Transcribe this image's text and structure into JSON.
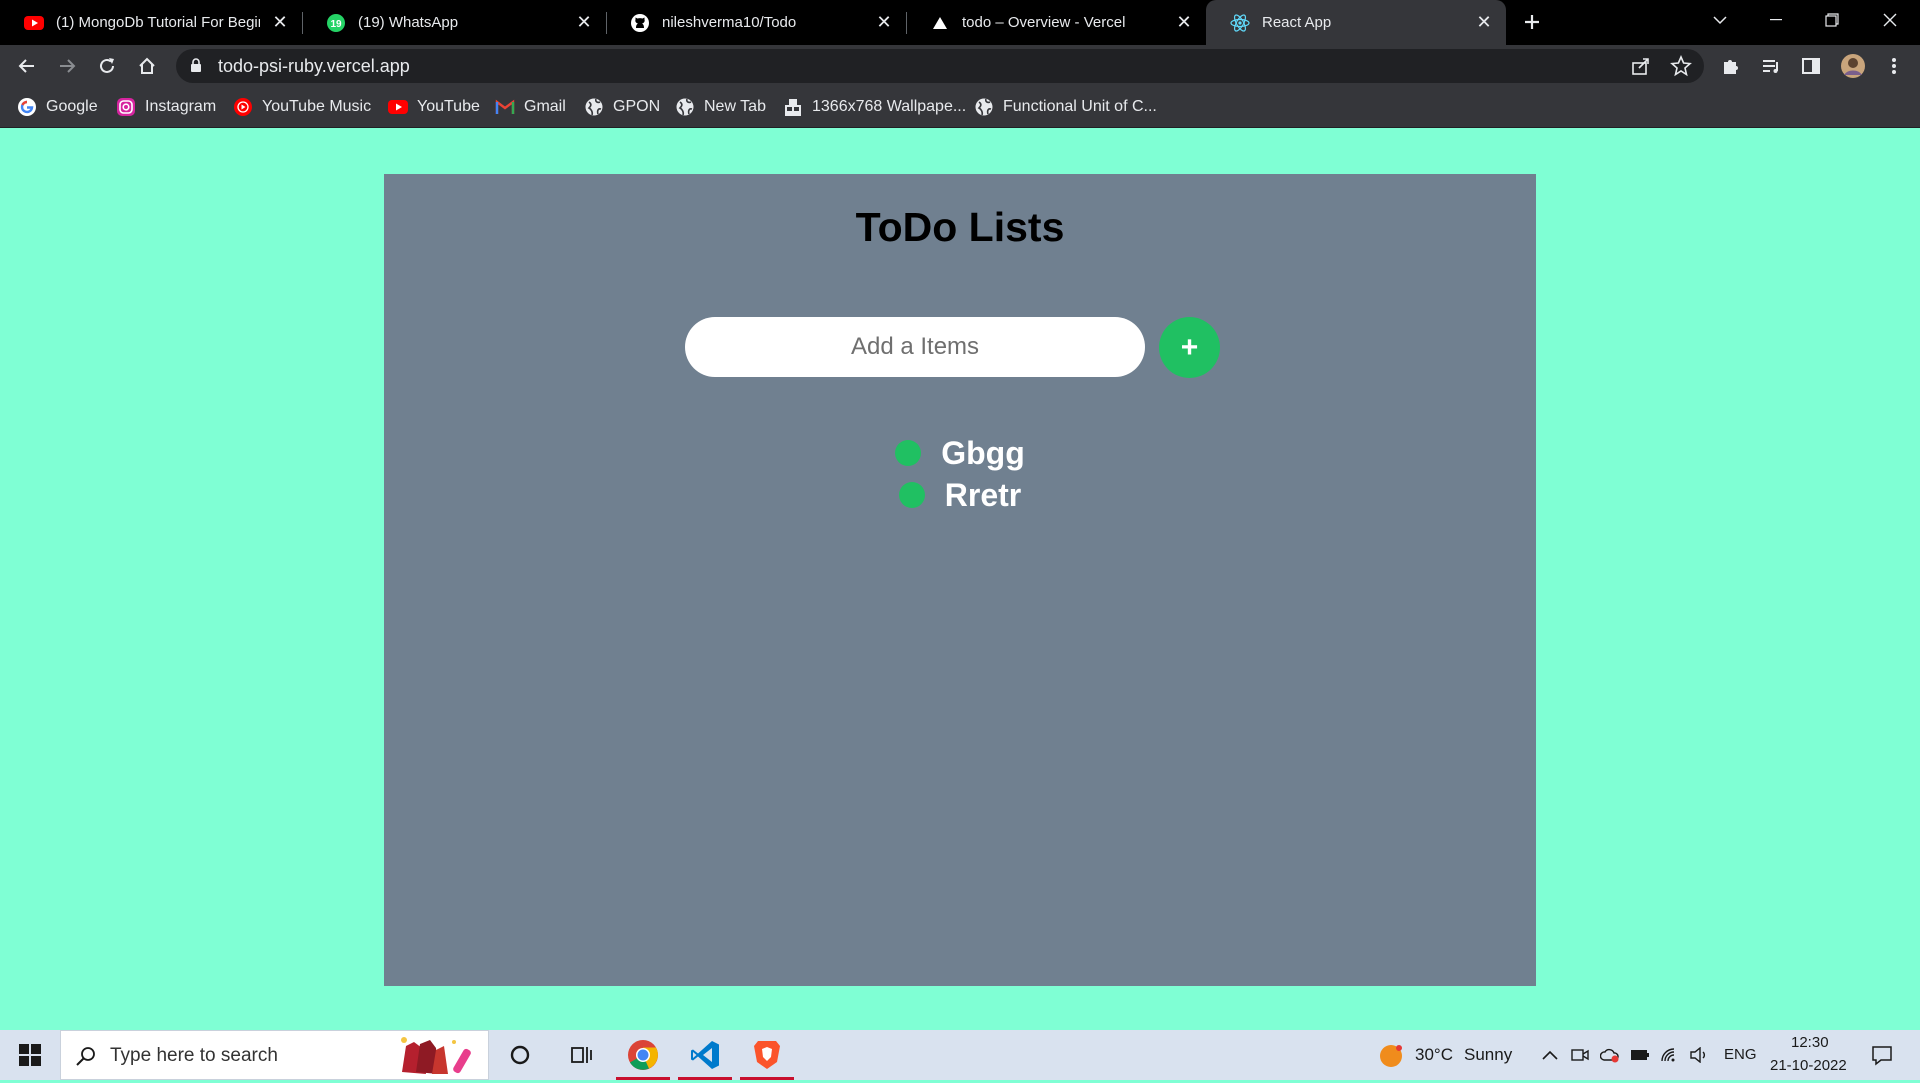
{
  "browser": {
    "tabs": [
      {
        "title": "(1) MongoDb Tutorial For Beginn",
        "icon": "youtube-icon"
      },
      {
        "title": "(19) WhatsApp",
        "icon": "whatsapp-icon"
      },
      {
        "title": "nileshverma10/Todo",
        "icon": "github-icon"
      },
      {
        "title": "todo – Overview - Vercel",
        "icon": "vercel-icon"
      },
      {
        "title": "React App",
        "icon": "react-icon",
        "active": true
      }
    ],
    "close_glyph": "✕",
    "new_tab_glyph": "+",
    "url": "todo-psi-ruby.vercel.app",
    "bookmarks": [
      {
        "label": "Google",
        "icon": "google-icon"
      },
      {
        "label": "Instagram",
        "icon": "instagram-icon"
      },
      {
        "label": "YouTube Music",
        "icon": "youtube-music-icon"
      },
      {
        "label": "YouTube",
        "icon": "youtube-icon"
      },
      {
        "label": "Gmail",
        "icon": "gmail-icon"
      },
      {
        "label": "GPON",
        "icon": "globe-icon"
      },
      {
        "label": "New Tab",
        "icon": "globe-icon"
      },
      {
        "label": "1366x768 Wallpape...",
        "icon": "wallpaper-icon"
      },
      {
        "label": "Functional Unit of C...",
        "icon": "globe-icon"
      }
    ]
  },
  "app": {
    "title": "ToDo Lists",
    "input_placeholder": "Add a Items",
    "add_button_label": "+",
    "items": [
      "Gbgg",
      "Rretr"
    ]
  },
  "taskbar": {
    "search_placeholder": "Type here to search",
    "weather_temp": "30°C",
    "weather_desc": "Sunny",
    "language": "ENG",
    "time": "12:30",
    "date": "21-10-2022"
  },
  "colors": {
    "page_bg": "#7fffd4",
    "card_bg": "#708090",
    "accent_green": "#20c062"
  }
}
